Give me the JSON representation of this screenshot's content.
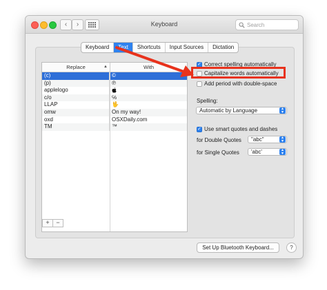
{
  "window": {
    "title": "Keyboard",
    "search_placeholder": "Search",
    "nav": {
      "back": "‹",
      "forward": "›"
    }
  },
  "tabs": [
    {
      "label": "Keyboard",
      "active": false
    },
    {
      "label": "Text",
      "active": true
    },
    {
      "label": "Shortcuts",
      "active": false
    },
    {
      "label": "Input Sources",
      "active": false
    },
    {
      "label": "Dictation",
      "active": false
    }
  ],
  "table": {
    "headers": {
      "replace": "Replace",
      "with": "With"
    },
    "rows": [
      {
        "replace": "(c)",
        "with": "©",
        "selected": true
      },
      {
        "replace": "(p)",
        "with": "℗",
        "selected": false
      },
      {
        "replace": "applelogo",
        "with": "",
        "selected": false
      },
      {
        "replace": "c/o",
        "with": "℅",
        "selected": false
      },
      {
        "replace": "LLAP",
        "with": "🖖",
        "selected": false
      },
      {
        "replace": "omw",
        "with": "On my way!",
        "selected": false
      },
      {
        "replace": "oxd",
        "with": "OSXDaily.com",
        "selected": false
      },
      {
        "replace": "TM",
        "with": "™",
        "selected": false
      }
    ],
    "add": "+",
    "remove": "−"
  },
  "options": {
    "correct_spelling": {
      "label": "Correct spelling automatically",
      "checked": true
    },
    "capitalize": {
      "label": "Capitalize words automatically",
      "checked": false
    },
    "add_period": {
      "label": "Add period with double-space",
      "checked": false
    },
    "spelling_label": "Spelling:",
    "spelling_value": "Automatic by Language",
    "smart_quotes": {
      "label": "Use smart quotes and dashes",
      "checked": true
    },
    "double_quotes_label": "for Double Quotes",
    "double_quotes_value": "\"abc\"",
    "single_quotes_label": "for Single Quotes",
    "single_quotes_value": "'abc'"
  },
  "footer": {
    "bluetooth_button": "Set Up Bluetooth Keyboard...",
    "help": "?"
  },
  "colors": {
    "accent": "#2e82ef",
    "annotation_red": "#e8321c"
  }
}
